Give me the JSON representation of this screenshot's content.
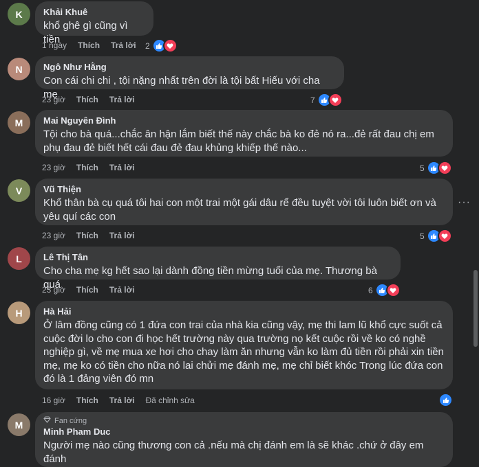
{
  "labels": {
    "like": "Thích",
    "reply": "Trả lời",
    "edited": "Đã chỉnh sửa"
  },
  "colors": {
    "background": "#242526",
    "bubble": "#3a3b3c",
    "like": "#2d88ff",
    "love": "#f33e58"
  },
  "comments": [
    {
      "author": "Khải Khuê",
      "text": "khổ ghê gì cũng vì tiền",
      "time": "1 ngày",
      "reactions": "2",
      "reaction_icons": [
        "like-icon",
        "love-icon"
      ],
      "avatar_initial": "K"
    },
    {
      "author": "Ngô Như Hằng",
      "text": "Con cái chi chi , tội nặng nhất trên đời là tội bất Hiếu với cha mẹ",
      "time": "23 giờ",
      "reactions": "7",
      "reaction_icons": [
        "like-icon",
        "love-icon"
      ],
      "avatar_initial": "N"
    },
    {
      "author": "Mai Nguyên Đình",
      "text": "Tội cho bà quá...chắc ân hận lắm biết thế này chắc bà ko đẻ nó ra...đẻ rất đau chị em phụ đau đẻ biết hết cái đau đẻ đau khủng khiếp thế nào...",
      "time": "23 giờ",
      "reactions": "5",
      "reaction_icons": [
        "like-icon",
        "love-icon"
      ],
      "avatar_initial": "M"
    },
    {
      "author": "Vũ Thiện",
      "text": "Khổ thân bà cụ quá tôi hai con một trai một gái dâu rể đều tuyệt vời tôi luôn biết ơn và yêu quí các con",
      "time": "23 giờ",
      "reactions": "5",
      "reaction_icons": [
        "like-icon",
        "love-icon"
      ],
      "avatar_initial": "V",
      "more": "···"
    },
    {
      "author": "Lê Thị Tân",
      "text": "Cho cha mẹ kg hết sao lại dành đồng tiền mừng tuổi của mẹ. Thương bà quá",
      "time": "23 giờ",
      "reactions": "6",
      "reaction_icons": [
        "like-icon",
        "love-icon"
      ],
      "avatar_initial": "L"
    },
    {
      "author": "Hà Hải",
      "text": "Ở lâm đồng cũng có 1 đứa con trai của nhà kia cũng vậy, mẹ thi lam lũ khổ cực suốt cả cuộc đời lo cho con đi học hết trường này qua trường nọ kết cuộc rồi về ko có nghề nghiệp gì, về mẹ mua xe hơi cho chay làm ăn nhưng vẫn ko làm đủ tiền rồi phải xin tiền mẹ, mẹ ko có tiền cho nữa nó lai chửi mẹ đánh mẹ, mẹ chỉ biết khóc Trong lúc đứa con đó là 1 đảng viên đó mn",
      "time": "16 giờ",
      "reactions": "",
      "reaction_icons": [
        "like-icon"
      ],
      "avatar_initial": "H",
      "edited": true
    },
    {
      "author": "Minh Pham Duc",
      "badge": "Fan cứng",
      "text": "Người mẹ nào cũng thương con cả .nếu mà chị đánh em là sẽ khác .chứ ở đây em đánh",
      "avatar_initial": "M"
    }
  ]
}
